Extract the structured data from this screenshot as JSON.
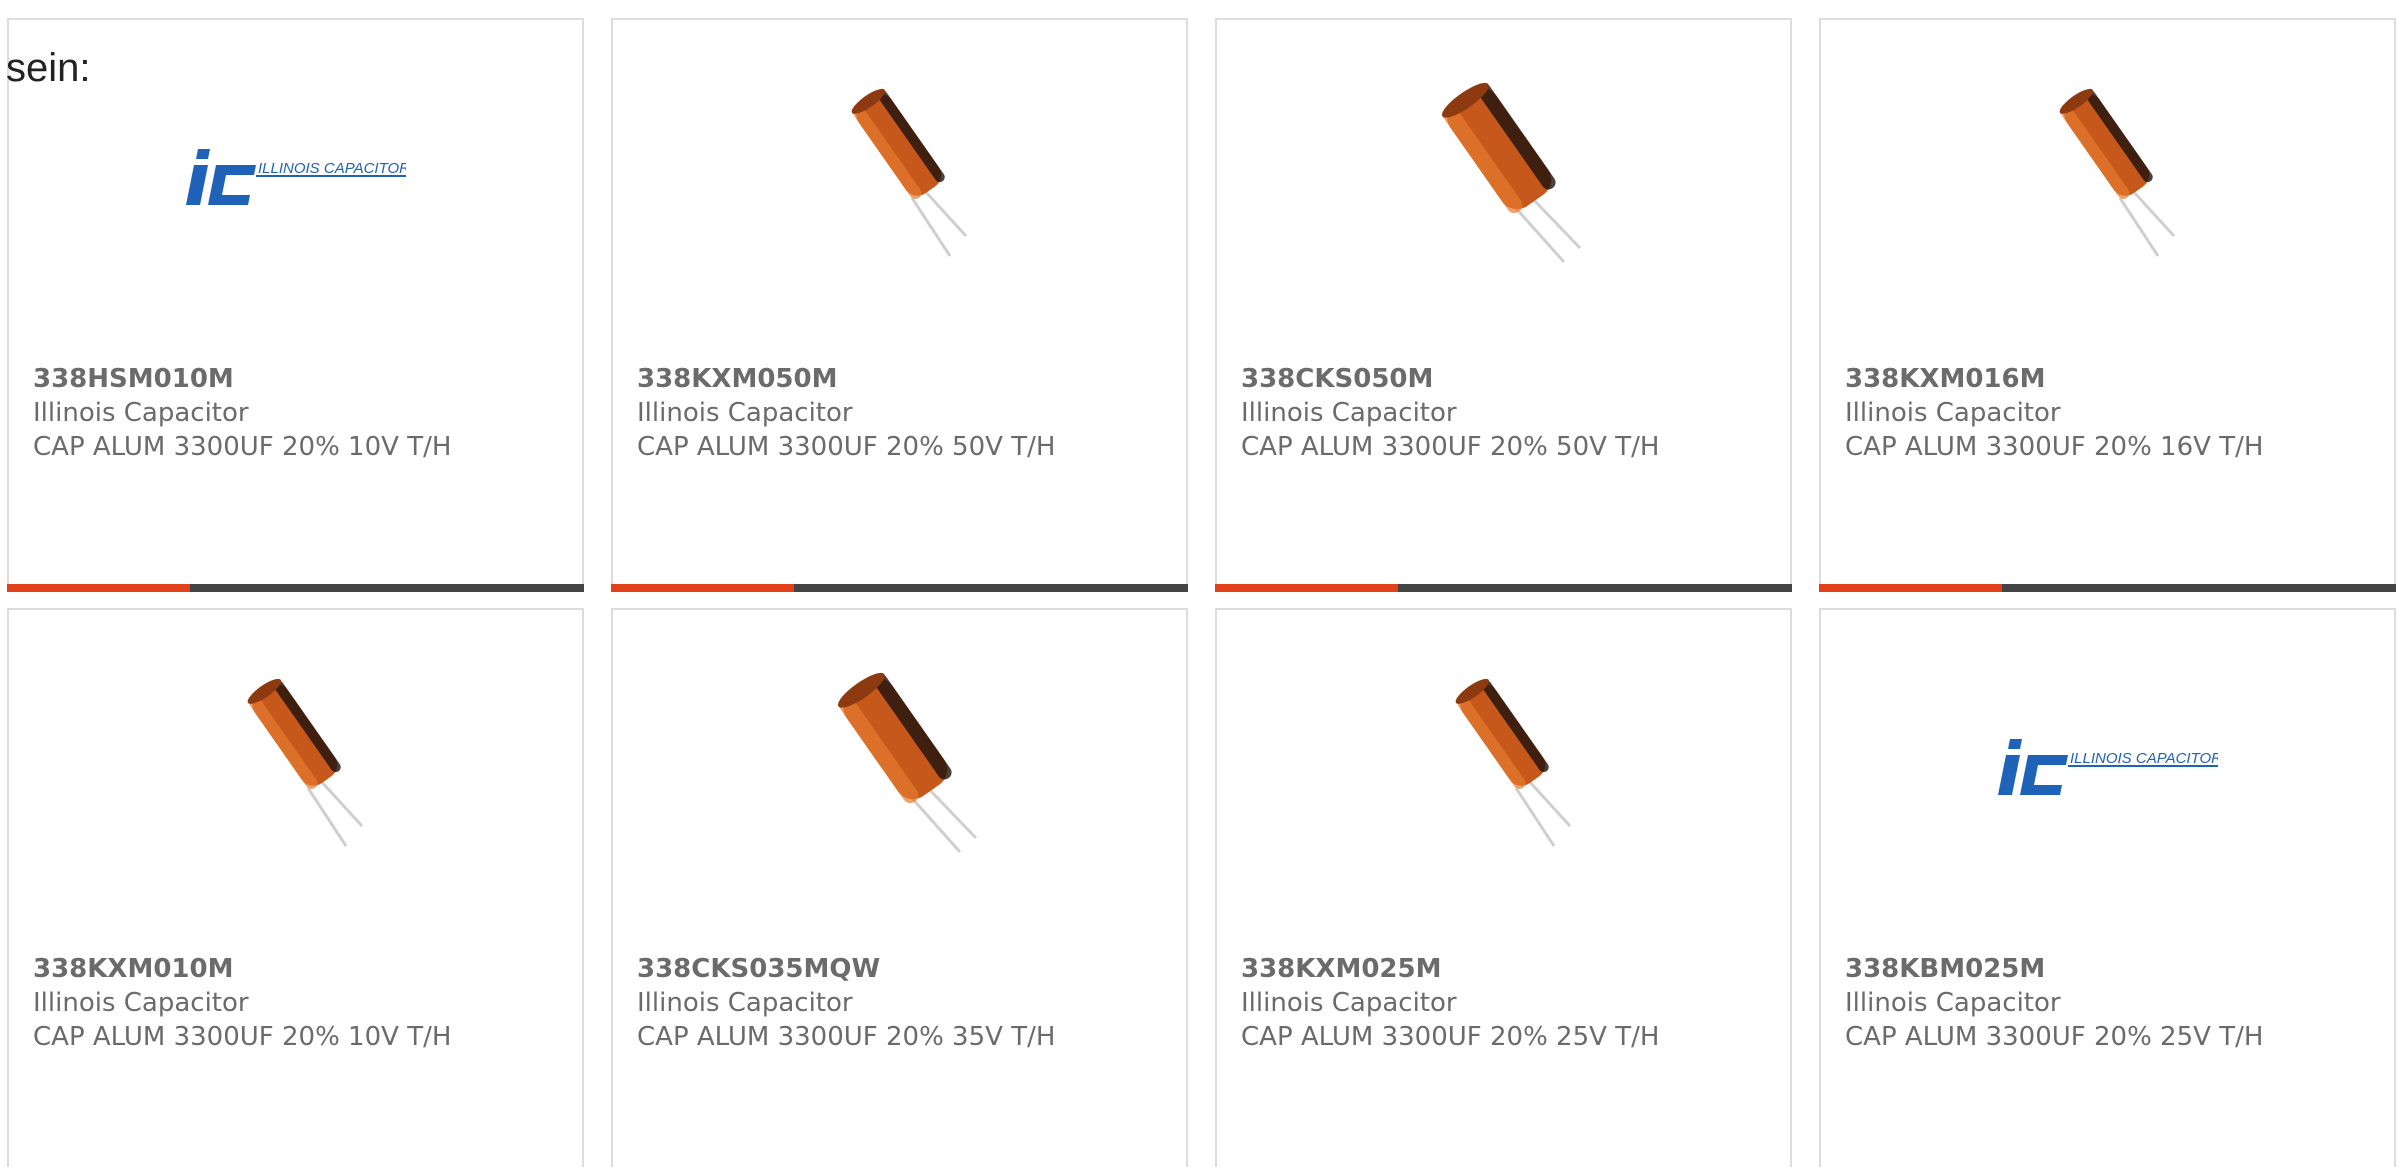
{
  "intro_text": "sein:",
  "colors": {
    "accent": "#e0401a",
    "bar": "#444444",
    "text": "#6b6b6b",
    "logo_blue": "#1f63b8"
  },
  "products": [
    {
      "part": "338HSM010M",
      "manufacturer": "Illinois Capacitor",
      "description": "CAP ALUM 3300UF 20% 10V T/H",
      "image": "illinois-capacitor-logo",
      "logo_text": "ILLINOIS CAPACITOR, INC."
    },
    {
      "part": "338KXM050M",
      "manufacturer": "Illinois Capacitor",
      "description": "CAP ALUM 3300UF 20% 50V T/H",
      "image": "capacitor-photo"
    },
    {
      "part": "338CKS050M",
      "manufacturer": "Illinois Capacitor",
      "description": "CAP ALUM 3300UF 20% 50V T/H",
      "image": "capacitor-photo"
    },
    {
      "part": "338KXM016M",
      "manufacturer": "Illinois Capacitor",
      "description": "CAP ALUM 3300UF 20% 16V T/H",
      "image": "capacitor-photo"
    },
    {
      "part": "338KXM010M",
      "manufacturer": "Illinois Capacitor",
      "description": "CAP ALUM 3300UF 20% 10V T/H",
      "image": "capacitor-photo"
    },
    {
      "part": "338CKS035MQW",
      "manufacturer": "Illinois Capacitor",
      "description": "CAP ALUM 3300UF 20% 35V T/H",
      "image": "capacitor-photo"
    },
    {
      "part": "338KXM025M",
      "manufacturer": "Illinois Capacitor",
      "description": "CAP ALUM 3300UF 20% 25V T/H",
      "image": "capacitor-photo"
    },
    {
      "part": "338KBM025M",
      "manufacturer": "Illinois Capacitor",
      "description": "CAP ALUM 3300UF 20% 25V T/H",
      "image": "illinois-capacitor-logo",
      "logo_text": "ILLINOIS CAPACITOR, INC."
    }
  ]
}
